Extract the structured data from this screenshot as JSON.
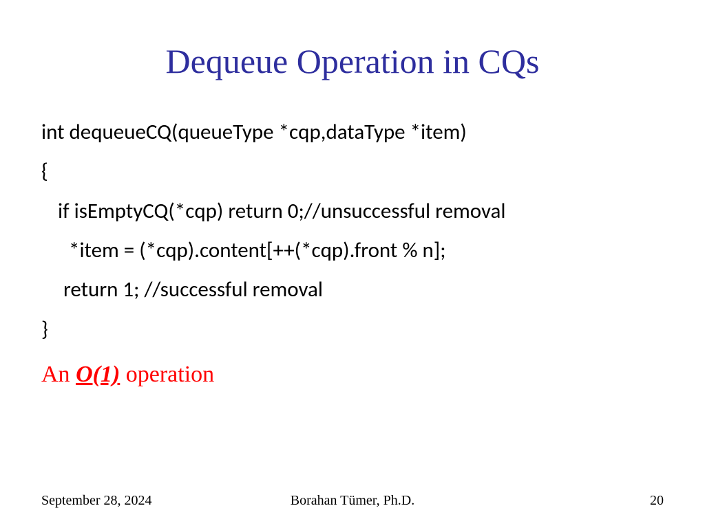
{
  "title": "Dequeue Operation in CQs",
  "code": {
    "line1": "int dequeueCQ(queueType *cqp,dataType *item)",
    "line2": "{",
    "line3": "if isEmptyCQ(*cqp) return 0;//unsuccessful removal",
    "line4": "*item = (*cqp).content[++(*cqp).front % n];",
    "line5": "return 1;  //successful removal",
    "line6": "}"
  },
  "complexity": {
    "prefix": "An ",
    "bigo": "O(1)",
    "suffix": " operation"
  },
  "footer": {
    "date": "September 28, 2024",
    "author": "Borahan Tümer, Ph.D.",
    "page": "20"
  }
}
